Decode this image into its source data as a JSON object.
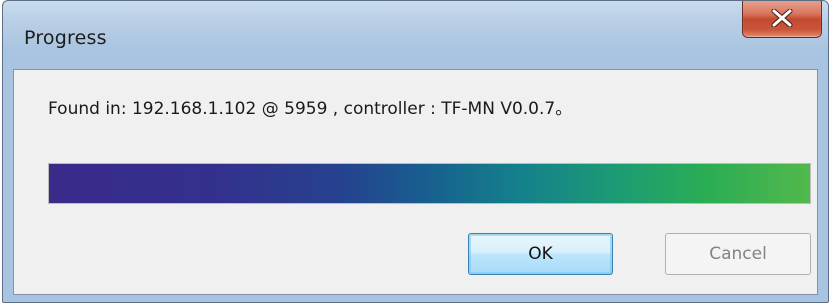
{
  "window": {
    "title": "Progress"
  },
  "close_button": {
    "icon": "close-icon"
  },
  "content": {
    "message": "Found in: 192.168.1.102 @ 5959 , controller : TF-MN V0.0.7。"
  },
  "progress": {
    "value_percent": 100,
    "gradient_colors": [
      "#3a2a8a",
      "#26418f",
      "#17608f",
      "#14818b",
      "#2aad55",
      "#52b84b"
    ]
  },
  "buttons": {
    "ok_label": "OK",
    "cancel_label": "Cancel"
  },
  "colors": {
    "close_button": "#c94a2e",
    "ok_border": "#3c7fb1",
    "disabled_text": "#838383"
  }
}
